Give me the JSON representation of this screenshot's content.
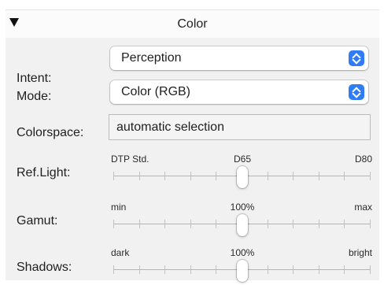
{
  "header": {
    "title": "Color"
  },
  "rows": {
    "intent": {
      "label": "Intent:",
      "value": "Perception"
    },
    "mode": {
      "label": "Mode:",
      "value": "Color (RGB)"
    },
    "colorspace": {
      "label": "Colorspace:",
      "value": "automatic selection"
    },
    "ref_light": {
      "label": "Ref.Light:",
      "min_label": "DTP Std.",
      "mid_label": "D65",
      "max_label": "D80",
      "position": 0.5
    },
    "gamut": {
      "label": "Gamut:",
      "min_label": "min",
      "mid_label": "100%",
      "max_label": "max",
      "position": 0.5
    },
    "shadows": {
      "label": "Shadows:",
      "min_label": "dark",
      "mid_label": "100%",
      "max_label": "bright",
      "position": 0.5
    }
  },
  "colors": {
    "accent": "#2f7cf6",
    "panel_bg": "#f1f1f1"
  },
  "icons": {
    "disclosure": "disclosure-triangle-down-icon",
    "popup": "up-down-chevron-icon"
  }
}
